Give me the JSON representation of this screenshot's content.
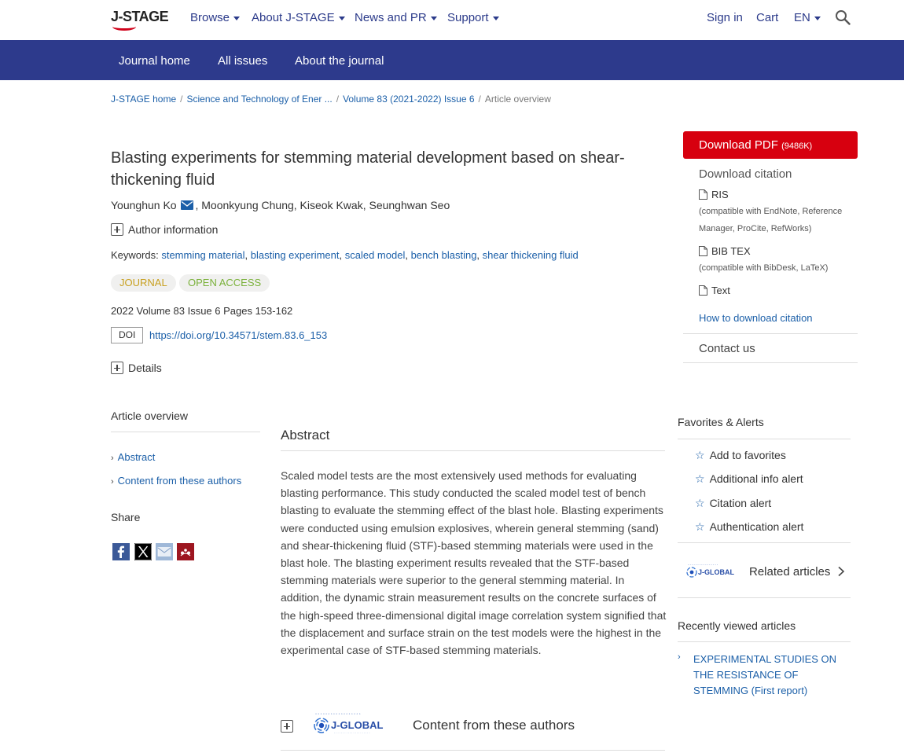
{
  "topnav": {
    "logo_text": "J-STAGE",
    "menu": [
      {
        "label": "Browse"
      },
      {
        "label": "About J-STAGE"
      },
      {
        "label": "News and PR"
      },
      {
        "label": "Support"
      }
    ],
    "sign_in": "Sign in",
    "cart": "Cart",
    "language": "EN",
    "search_icon": "search-icon"
  },
  "journal_nav": {
    "items": [
      "Journal home",
      "All issues",
      "About the journal"
    ]
  },
  "breadcrumb": {
    "items": [
      "J-STAGE home",
      "Science and Technology of Ener ...",
      "Volume 83 (2021-2022) Issue 6"
    ],
    "current": "Article overview"
  },
  "article": {
    "title": "Blasting experiments for stemming material development based on shear-thickening fluid",
    "first_author": "Younghun Ko",
    "other_authors": ", Moonkyung Chung, Kiseok Kwak, Seunghwan Seo",
    "author_info_label": "Author information",
    "keywords_label": "Keywords:",
    "keywords": [
      "stemming material",
      "blasting experiment",
      "scaled model",
      "bench blasting",
      "shear thickening fluid"
    ],
    "badges": {
      "journal": "JOURNAL",
      "open_access": "OPEN ACCESS"
    },
    "volume_info": "2022 Volume 83 Issue 6 Pages 153-162",
    "doi_label": "DOI",
    "doi_url": "https://doi.org/10.34571/stem.83.6_153",
    "details_label": "Details"
  },
  "download": {
    "pdf_label": "Download PDF",
    "pdf_size": "(9486K)",
    "citation_heading": "Download citation",
    "formats": [
      {
        "label": "RIS",
        "note": "(compatible with EndNote, Reference Manager, ProCite, RefWorks)"
      },
      {
        "label": "BIB TEX",
        "note": "(compatible with BibDesk, LaTeX)"
      },
      {
        "label": "Text",
        "note": ""
      }
    ],
    "how_to": "How to download citation",
    "contact": "Contact us"
  },
  "sidebar": {
    "overview_heading": "Article overview",
    "links": [
      "Abstract",
      "Content from these authors"
    ],
    "share_heading": "Share",
    "share_icons": [
      "facebook-icon",
      "x-icon",
      "email-icon",
      "mendeley-icon"
    ]
  },
  "abstract": {
    "heading": "Abstract",
    "text": "Scaled model tests are the most extensively used methods for evaluating blasting performance. This study conducted the scaled model test of bench blasting to evaluate the stemming effect of the blast hole. Blasting experiments were conducted using emulsion explosives, wherein general stemming (sand) and shear-thickening fluid (STF)-based stemming materials were used in the blast hole. The blasting experiment results revealed that the STF-based stemming materials were superior to the general stemming material. In addition, the dynamic strain measurement results on the concrete surfaces of the high-speed three-dimensional digital image correlation system signified that the displacement and surface strain on the test models were the highest in the experimental case of STF-based stemming materials.",
    "content_authors_heading": "Content from these authors",
    "jglobal_text": "J-GLOBAL"
  },
  "favorites": {
    "heading": "Favorites & Alerts",
    "items": [
      "Add to favorites",
      "Additional info alert",
      "Citation alert",
      "Authentication alert"
    ],
    "related": "Related articles",
    "jglobal_text": "J-GLOBAL"
  },
  "recently_viewed": {
    "heading": "Recently viewed articles",
    "items": [
      "EXPERIMENTAL STUDIES ON THE RESISTANCE OF STEMMING (First report)"
    ]
  },
  "colors": {
    "nav_text": "#2b3a8a",
    "journal_bar": "#2d3a8c",
    "link": "#1b5fa8",
    "pdf_button": "#d7000f",
    "journal_badge": "#c8a020",
    "open_access_badge": "#7ab13a"
  }
}
